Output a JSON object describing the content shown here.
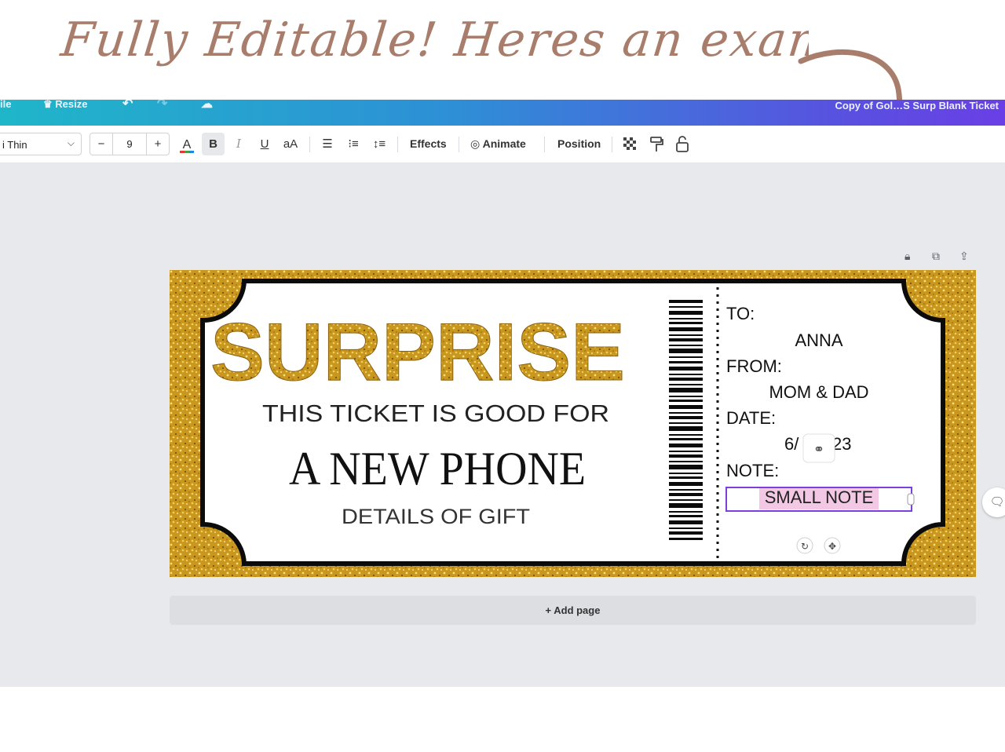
{
  "headline": "Fully Editable! Heres an example",
  "topbar": {
    "file_label": "ile",
    "resize_label": "Resize",
    "doc_title": "Copy of Gol…S Surp Blank Ticket"
  },
  "toolbar": {
    "font_name": "i Thin",
    "font_size": "9",
    "minus": "−",
    "plus": "+",
    "effects_label": "Effects",
    "animate_label": "Animate",
    "position_label": "Position"
  },
  "ticket": {
    "headline": "SURPRISE",
    "line1": "THIS TICKET IS GOOD FOR",
    "gift": "A NEW PHONE",
    "details": "DETAILS OF GIFT",
    "to_label": "TO:",
    "to_value": "ANNA",
    "from_label": "FROM:",
    "from_value": "MOM & DAD",
    "date_label": "DATE:",
    "date_value_left": "6/",
    "date_value_right": "23",
    "note_label": "NOTE:",
    "note_value": "SMALL NOTE"
  },
  "add_page_label": "+ Add page",
  "colors": {
    "accent_headline": "#a97d6c",
    "gradient_start": "#1fb6c9",
    "gradient_end": "#6a3fe6",
    "gold": "#c9971e",
    "selection": "#7b3fe0"
  }
}
